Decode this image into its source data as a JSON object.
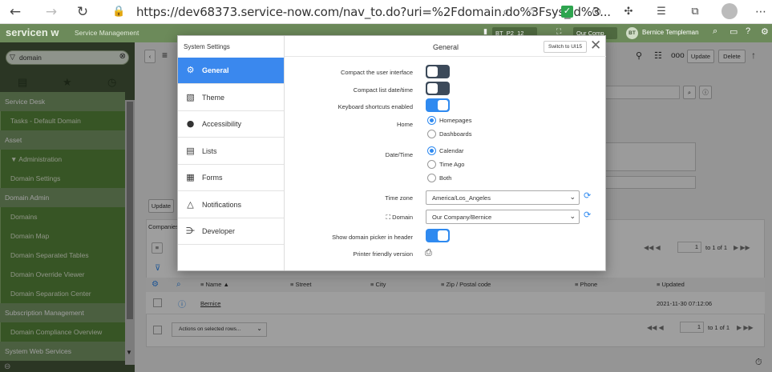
{
  "browser": {
    "url": "https://dev68373.service-now.com/nav_to.do?uri=%2Fdomain.do%3Fsys_id%3..."
  },
  "header": {
    "logo": "servicen",
    "logo_w": "w",
    "product": "Service Management",
    "context1": "BT_P2_12",
    "context2": "Our Comp",
    "user_initials": "BT",
    "user_name": "Bernice Templeman"
  },
  "nav": {
    "filter_value": "domain",
    "rows": [
      {
        "label": "Service Desk",
        "kind": "section"
      },
      {
        "label": "Tasks - Default Domain",
        "kind": "item"
      },
      {
        "label": "Asset",
        "kind": "section"
      },
      {
        "label": "▼ Administration",
        "kind": "item"
      },
      {
        "label": "Domain Settings",
        "kind": "item"
      },
      {
        "label": "Domain Admin",
        "kind": "section"
      },
      {
        "label": "Domains",
        "kind": "item"
      },
      {
        "label": "Domain Map",
        "kind": "item"
      },
      {
        "label": "Domain Separated Tables",
        "kind": "item"
      },
      {
        "label": "Domain Override Viewer",
        "kind": "item"
      },
      {
        "label": "Domain Separation Center",
        "kind": "item"
      },
      {
        "label": "Subscription Management",
        "kind": "section"
      },
      {
        "label": "Domain Compliance Overview",
        "kind": "item"
      },
      {
        "label": "System Web Services",
        "kind": "section"
      }
    ]
  },
  "form": {
    "update_label": "Update",
    "delete_label": "Delete",
    "update_bottom": "Update",
    "companies_tab": "Companies",
    "table_columns": [
      "Name ▲",
      "Street",
      "City",
      "Zip / Postal code",
      "Phone",
      "Updated"
    ],
    "row": {
      "name": "Bernice",
      "updated": "2021-11-30 07:12:06"
    },
    "actions_label": "Actions on selected rows...",
    "pager_value": "1",
    "pager_text": "to 1 of 1"
  },
  "modal": {
    "side_title": "System Settings",
    "title": "General",
    "switch_label": "Switch to UI15",
    "categories": [
      {
        "label": "General",
        "icon": "gear-icon",
        "active": true
      },
      {
        "label": "Theme",
        "icon": "image-icon",
        "active": false
      },
      {
        "label": "Accessibility",
        "icon": "circle-icon",
        "active": false
      },
      {
        "label": "Lists",
        "icon": "list-icon",
        "active": false
      },
      {
        "label": "Forms",
        "icon": "form-icon",
        "active": false
      },
      {
        "label": "Notifications",
        "icon": "bell-icon",
        "active": false
      },
      {
        "label": "Developer",
        "icon": "developer-icon",
        "active": false
      }
    ],
    "settings": {
      "compact_ui": {
        "label": "Compact the user interface",
        "on": false
      },
      "compact_list": {
        "label": "Compact list date/time",
        "on": false
      },
      "keyboard": {
        "label": "Keyboard shortcuts enabled",
        "on": true
      },
      "home": {
        "label": "Home",
        "options": [
          "Homepages",
          "Dashboards"
        ],
        "selected": "Homepages"
      },
      "datetime": {
        "label": "Date/Time",
        "options": [
          "Calendar",
          "Time Ago",
          "Both"
        ],
        "selected": "Calendar"
      },
      "timezone": {
        "label": "Time zone",
        "value": "America/Los_Angeles"
      },
      "domain": {
        "label": "Domain",
        "value": "Our Company/Bernice"
      },
      "domain_picker": {
        "label": "Show domain picker in header",
        "on": true
      },
      "printer": {
        "label": "Printer friendly version"
      }
    }
  },
  "colors": {
    "header_green": "#6c8a5a",
    "nav_green": "#5a8a3c",
    "accent_blue": "#2f8af0"
  }
}
